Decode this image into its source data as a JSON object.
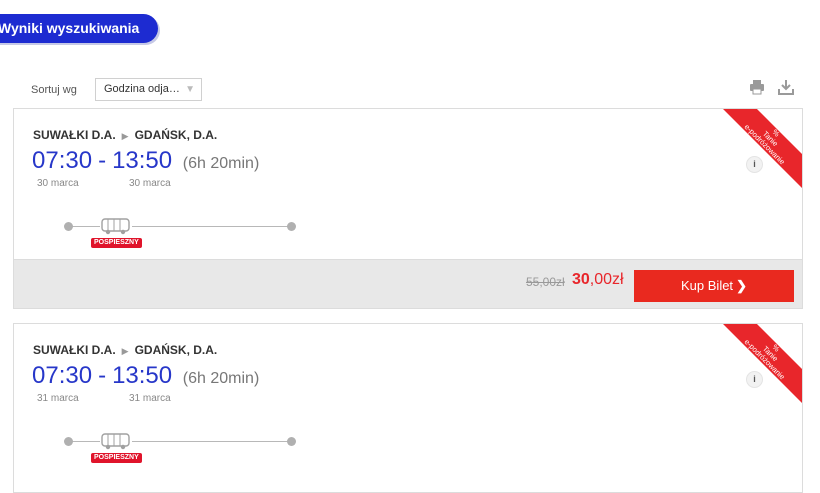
{
  "header": {
    "title": "Wyniki wyszukiwania"
  },
  "sort": {
    "label": "Sortuj wg",
    "selected": "Godzina odja…"
  },
  "results": [
    {
      "from": "SUWAŁKI D.A.",
      "to": "GDAŃSK, D.A.",
      "depart": "07:30",
      "arrive": "13:50",
      "duration": "(6h 20min)",
      "depart_date": "30 marca",
      "arrive_date": "30 marca",
      "badge": "POSPIESZNY",
      "ribbon": {
        "line1": "%",
        "line2": "Tanie",
        "line3": "e-podróżowanie"
      },
      "info": "i",
      "old_price": "55,00zł",
      "new_price_amount": "30",
      "new_price_rest": ",00zł",
      "buy_label": "Kup Bilet"
    },
    {
      "from": "SUWAŁKI D.A.",
      "to": "GDAŃSK, D.A.",
      "depart": "07:30",
      "arrive": "13:50",
      "duration": "(6h 20min)",
      "depart_date": "31 marca",
      "arrive_date": "31 marca",
      "badge": "POSPIESZNY",
      "ribbon": {
        "line1": "%",
        "line2": "Tanie",
        "line3": "e-podróżowanie"
      },
      "info": "i"
    }
  ],
  "colors": {
    "brand_blue": "#1d2bd1",
    "accent_red": "#e9291f"
  },
  "icons": {
    "print": "print-icon",
    "download": "download-icon",
    "bus": "bus-icon"
  }
}
